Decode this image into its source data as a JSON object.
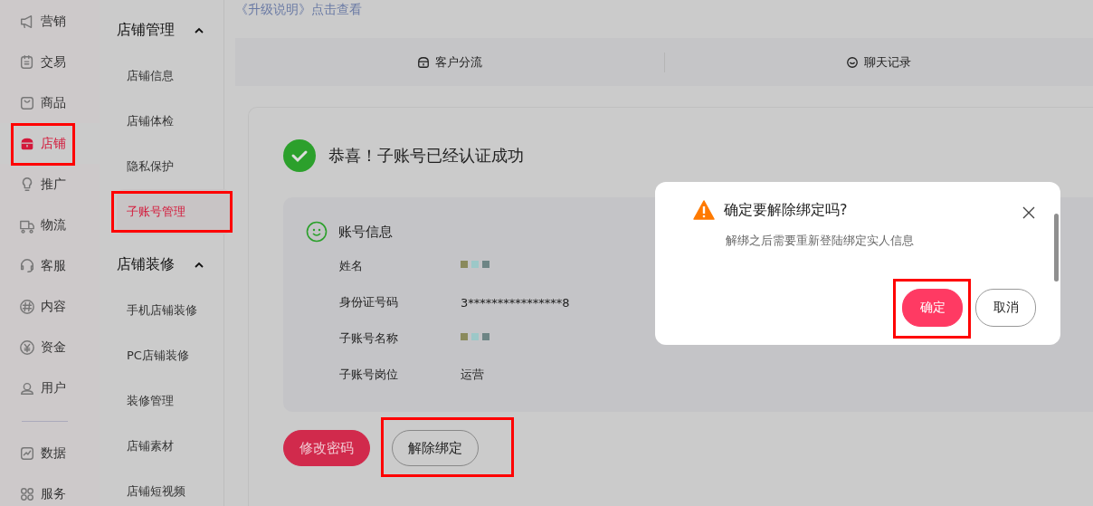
{
  "nav": [
    {
      "label": "营销",
      "selected": false,
      "annotated": false
    },
    {
      "label": "交易",
      "selected": false,
      "annotated": false
    },
    {
      "label": "商品",
      "selected": false,
      "annotated": false
    },
    {
      "label": "店铺",
      "selected": true,
      "annotated": true
    },
    {
      "label": "推广",
      "selected": false,
      "annotated": false
    },
    {
      "label": "物流",
      "selected": false,
      "annotated": false
    },
    {
      "label": "客服",
      "selected": false,
      "annotated": false
    },
    {
      "label": "内容",
      "selected": false,
      "annotated": false
    },
    {
      "label": "资金",
      "selected": false,
      "annotated": false
    },
    {
      "label": "用户",
      "selected": false,
      "annotated": false
    },
    {
      "label": "数据",
      "selected": false,
      "annotated": false
    },
    {
      "label": "服务",
      "selected": false,
      "annotated": false
    }
  ],
  "subnav": [
    {
      "title": "店铺管理",
      "expanded": true,
      "items": [
        {
          "label": "店铺信息",
          "selected": false,
          "annotated": false
        },
        {
          "label": "店铺体检",
          "selected": false,
          "annotated": false
        },
        {
          "label": "隐私保护",
          "selected": false,
          "annotated": false
        },
        {
          "label": "子账号管理",
          "selected": true,
          "annotated": true
        }
      ]
    },
    {
      "title": "店铺装修",
      "expanded": true,
      "items": [
        {
          "label": "手机店铺装修",
          "selected": false,
          "annotated": false
        },
        {
          "label": "PC店铺装修",
          "selected": false,
          "annotated": false
        },
        {
          "label": "装修管理",
          "selected": false,
          "annotated": false
        },
        {
          "label": "店铺素材",
          "selected": false,
          "annotated": false
        },
        {
          "label": "店铺短视频",
          "selected": false,
          "annotated": false
        }
      ]
    }
  ],
  "upgrade_link": "《升级说明》点击查看",
  "tabs": [
    {
      "label": "客户分流"
    },
    {
      "label": "聊天记录"
    }
  ],
  "success_message": "恭喜！子账号已经认证成功",
  "account_info": {
    "title": "账号信息",
    "rows": [
      {
        "label": "姓名",
        "redacted": true
      },
      {
        "label": "身份证号码",
        "value": "3****************8",
        "redacted": false
      },
      {
        "label": "子账号名称",
        "redacted": true
      },
      {
        "label": "子账号岗位",
        "value": "运营",
        "redacted": false
      }
    ]
  },
  "actions": [
    {
      "label": "修改密码",
      "kind": "primary",
      "annotated": false
    },
    {
      "label": "解除绑定",
      "kind": "outline",
      "annotated": true
    }
  ],
  "dialog": {
    "title": "确定要解除绑定吗?",
    "message": "解绑之后需要重新登陆绑定实人信息",
    "buttons": [
      {
        "label": "确定",
        "kind": "primary",
        "annotated": true
      },
      {
        "label": "取消",
        "kind": "outline",
        "annotated": false
      }
    ]
  }
}
